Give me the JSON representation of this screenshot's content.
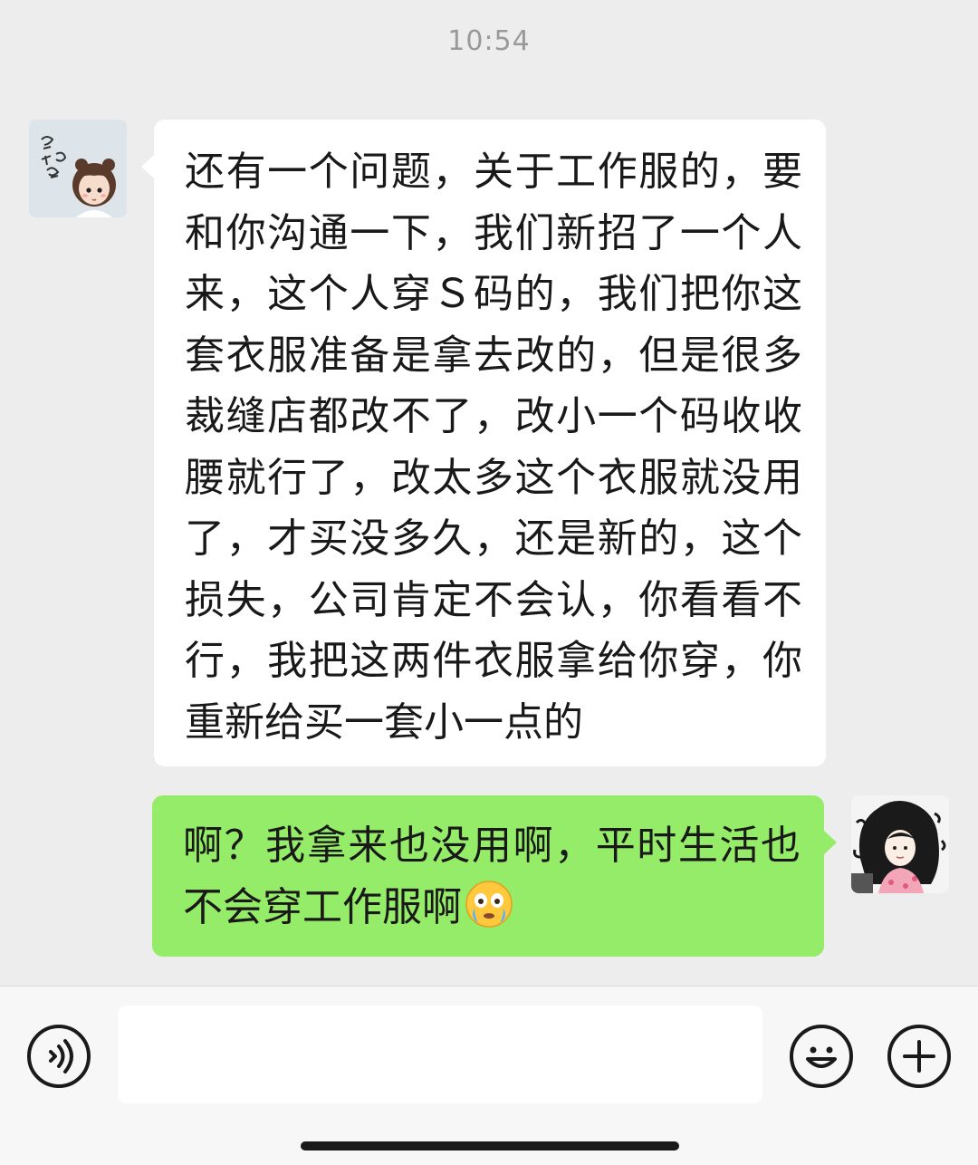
{
  "chat": {
    "timestamp": "10:54",
    "messages": [
      {
        "sender": "other",
        "text": "还有一个问题，关于工作服的，要和你沟通一下，我们新招了一个人来，这个人穿Ｓ码的，我们把你这套衣服准备是拿去改的，但是很多裁缝店都改不了，改小一个码收收腰就行了，改太多这个衣服就没用了，才买没多久，还是新的，这个损失，公司肯定不会认，你看看不行，我把这两件衣服拿给你穿，你重新给买一套小一点的",
        "avatar_text": "忽 钱 想 屎"
      },
      {
        "sender": "self",
        "text": "啊？我拿来也没用啊，平时生活也不会穿工作服啊",
        "emoji": "crying-face-emoji"
      }
    ]
  },
  "input_bar": {
    "placeholder": "",
    "value": "",
    "icons": [
      "voice-icon",
      "emoji-icon",
      "plus-icon"
    ]
  },
  "colors": {
    "background": "#ededed",
    "incoming_bubble": "#ffffff",
    "outgoing_bubble": "#95ec69",
    "text": "#191919",
    "timestamp": "#9a9a9a"
  }
}
